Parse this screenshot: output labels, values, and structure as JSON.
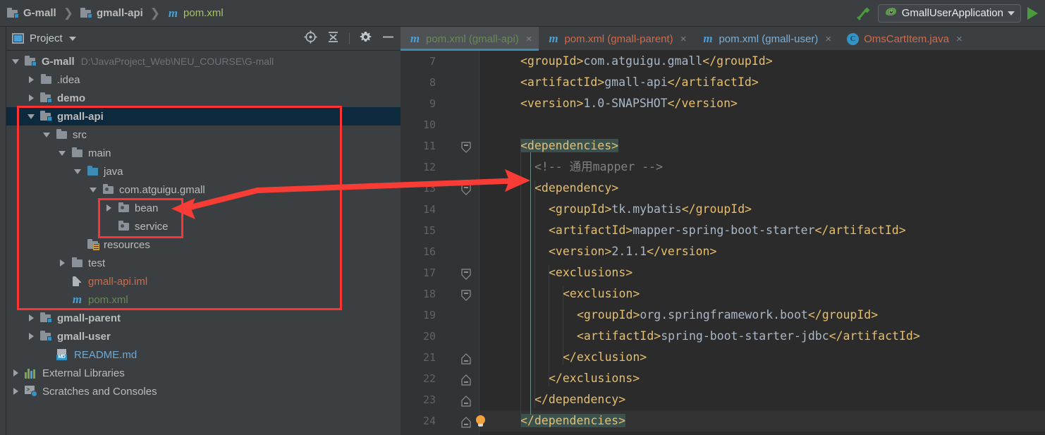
{
  "navbar": {
    "breadcrumbs": [
      {
        "label": "G-mall",
        "icon": "module-folder-icon",
        "style": "bold"
      },
      {
        "label": "gmall-api",
        "icon": "module-folder-icon",
        "style": "bold"
      },
      {
        "label": "pom.xml",
        "icon": "maven-m-icon",
        "style": "green"
      }
    ],
    "separator": "❯",
    "hammer_icon": "hammer-build-icon",
    "run_config": {
      "label": "GmallUserApplication",
      "icon": "spring-boot-icon",
      "caret": "chevron-down-icon"
    },
    "run_button": "run-play-icon",
    "accent_green": "#4a9b3e"
  },
  "project_panel": {
    "title": "Project",
    "title_icon": "project-view-icon",
    "caret": "chevron-down-icon",
    "actions": [
      {
        "name": "locate-target-icon",
        "glyph": "⊕"
      },
      {
        "name": "collapse-all-icon",
        "glyph": "⤓"
      },
      {
        "name": "settings-gear-icon",
        "glyph": "⚙"
      },
      {
        "name": "hide-panel-icon",
        "glyph": "—"
      }
    ]
  },
  "tree": [
    {
      "label": "G-mall",
      "sub": "D:\\JavaProject_Web\\NEU_COURSE\\G-mall",
      "depth": 0,
      "arrow": "open",
      "icon": "module-folder-icon",
      "bold": true,
      "color": "grey"
    },
    {
      "label": ".idea",
      "sub": "",
      "depth": 1,
      "arrow": "closed",
      "icon": "folder-icon",
      "bold": false,
      "color": "grey"
    },
    {
      "label": "demo",
      "sub": "",
      "depth": 1,
      "arrow": "closed",
      "icon": "module-folder-icon",
      "bold": true,
      "color": "grey"
    },
    {
      "label": "gmall-api",
      "sub": "",
      "depth": 1,
      "arrow": "open",
      "icon": "module-folder-icon",
      "bold": true,
      "color": "grey",
      "selected": true
    },
    {
      "label": "src",
      "sub": "",
      "depth": 2,
      "arrow": "open",
      "icon": "folder-icon",
      "bold": false,
      "color": "grey"
    },
    {
      "label": "main",
      "sub": "",
      "depth": 3,
      "arrow": "open",
      "icon": "folder-icon",
      "bold": false,
      "color": "grey"
    },
    {
      "label": "java",
      "sub": "",
      "depth": 4,
      "arrow": "open",
      "icon": "source-folder-icon",
      "bold": false,
      "color": "grey"
    },
    {
      "label": "com.atguigu.gmall",
      "sub": "",
      "depth": 5,
      "arrow": "open",
      "icon": "package-icon",
      "bold": false,
      "color": "grey"
    },
    {
      "label": "bean",
      "sub": "",
      "depth": 6,
      "arrow": "closed",
      "icon": "package-icon",
      "bold": false,
      "color": "grey"
    },
    {
      "label": "service",
      "sub": "",
      "depth": 6,
      "arrow": "none",
      "icon": "package-icon",
      "bold": false,
      "color": "grey"
    },
    {
      "label": "resources",
      "sub": "",
      "depth": 4,
      "arrow": "none",
      "icon": "resources-folder-icon",
      "bold": false,
      "color": "grey"
    },
    {
      "label": "test",
      "sub": "",
      "depth": 3,
      "arrow": "closed",
      "icon": "folder-icon",
      "bold": false,
      "color": "grey"
    },
    {
      "label": "gmall-api.iml",
      "sub": "",
      "depth": 3,
      "arrow": "none",
      "icon": "iml-file-icon",
      "bold": false,
      "color": "salmon"
    },
    {
      "label": "pom.xml",
      "sub": "",
      "depth": 3,
      "arrow": "none",
      "icon": "maven-m-icon",
      "bold": false,
      "color": "green"
    },
    {
      "label": "gmall-parent",
      "sub": "",
      "depth": 1,
      "arrow": "closed",
      "icon": "module-folder-icon",
      "bold": true,
      "color": "grey"
    },
    {
      "label": "gmall-user",
      "sub": "",
      "depth": 1,
      "arrow": "closed",
      "icon": "module-folder-icon",
      "bold": true,
      "color": "grey"
    },
    {
      "label": "README.md",
      "sub": "",
      "depth": 2,
      "arrow": "none",
      "icon": "markdown-file-icon",
      "bold": false,
      "color": "blue"
    },
    {
      "label": "External Libraries",
      "sub": "",
      "depth": 0,
      "arrow": "closed",
      "icon": "external-libraries-icon",
      "bold": false,
      "color": "grey"
    },
    {
      "label": "Scratches and Consoles",
      "sub": "",
      "depth": 0,
      "arrow": "closed",
      "icon": "scratches-icon",
      "bold": false,
      "color": "grey"
    }
  ],
  "tabs": [
    {
      "label": "pom.xml (gmall-api)",
      "icon": "maven-m-icon",
      "color": "green",
      "active": true,
      "close": "×"
    },
    {
      "label": "pom.xml (gmall-parent)",
      "icon": "maven-m-icon",
      "color": "salmon",
      "active": false,
      "close": "×"
    },
    {
      "label": "pom.xml (gmall-user)",
      "icon": "maven-m-icon",
      "color": "blue",
      "active": false,
      "close": "×"
    },
    {
      "label": "OmsCartItem.java",
      "icon": "java-class-icon",
      "color": "salmon",
      "active": false,
      "close": "×"
    }
  ],
  "editor": {
    "first_line": 7,
    "current_line": 24,
    "lines": [
      {
        "n": 7,
        "indent": 4,
        "segments": [
          {
            "t": "<groupId>",
            "c": "tag"
          },
          {
            "t": "com.atguigu.gmall",
            "c": "val"
          },
          {
            "t": "</groupId>",
            "c": "tag"
          }
        ]
      },
      {
        "n": 8,
        "indent": 4,
        "segments": [
          {
            "t": "<artifactId>",
            "c": "tag"
          },
          {
            "t": "gmall-api",
            "c": "val"
          },
          {
            "t": "</artifactId>",
            "c": "tag"
          }
        ]
      },
      {
        "n": 9,
        "indent": 4,
        "segments": [
          {
            "t": "<version>",
            "c": "tag"
          },
          {
            "t": "1.0-SNAPSHOT",
            "c": "val"
          },
          {
            "t": "</version>",
            "c": "tag"
          }
        ]
      },
      {
        "n": 10,
        "indent": 0,
        "segments": []
      },
      {
        "n": 11,
        "indent": 4,
        "fold": "start",
        "segments": [
          {
            "t": "<dependencies>",
            "c": "tag",
            "hl": true
          }
        ]
      },
      {
        "n": 12,
        "indent": 6,
        "segments": [
          {
            "t": "<!-- 通用mapper -->",
            "c": "cmt"
          }
        ]
      },
      {
        "n": 13,
        "indent": 6,
        "fold": "start",
        "segments": [
          {
            "t": "<dependency>",
            "c": "tag"
          }
        ]
      },
      {
        "n": 14,
        "indent": 8,
        "segments": [
          {
            "t": "<groupId>",
            "c": "tag"
          },
          {
            "t": "tk.mybatis",
            "c": "val"
          },
          {
            "t": "</groupId>",
            "c": "tag"
          }
        ]
      },
      {
        "n": 15,
        "indent": 8,
        "segments": [
          {
            "t": "<artifactId>",
            "c": "tag"
          },
          {
            "t": "mapper-spring-boot-starter",
            "c": "val"
          },
          {
            "t": "</artifactId>",
            "c": "tag"
          }
        ]
      },
      {
        "n": 16,
        "indent": 8,
        "segments": [
          {
            "t": "<version>",
            "c": "tag"
          },
          {
            "t": "2.1.1",
            "c": "val"
          },
          {
            "t": "</version>",
            "c": "tag"
          }
        ]
      },
      {
        "n": 17,
        "indent": 8,
        "fold": "start",
        "segments": [
          {
            "t": "<exclusions>",
            "c": "tag"
          }
        ]
      },
      {
        "n": 18,
        "indent": 10,
        "fold": "start",
        "segments": [
          {
            "t": "<exclusion>",
            "c": "tag"
          }
        ]
      },
      {
        "n": 19,
        "indent": 12,
        "segments": [
          {
            "t": "<groupId>",
            "c": "tag"
          },
          {
            "t": "org.springframework.boot",
            "c": "val"
          },
          {
            "t": "</groupId>",
            "c": "tag"
          }
        ]
      },
      {
        "n": 20,
        "indent": 12,
        "segments": [
          {
            "t": "<artifactId>",
            "c": "tag"
          },
          {
            "t": "spring-boot-starter-jdbc",
            "c": "val"
          },
          {
            "t": "</artifactId>",
            "c": "tag"
          }
        ]
      },
      {
        "n": 21,
        "indent": 10,
        "fold": "end",
        "segments": [
          {
            "t": "</exclusion>",
            "c": "tag"
          }
        ]
      },
      {
        "n": 22,
        "indent": 8,
        "fold": "end",
        "segments": [
          {
            "t": "</exclusions>",
            "c": "tag"
          }
        ]
      },
      {
        "n": 23,
        "indent": 6,
        "fold": "end",
        "segments": [
          {
            "t": "</dependency>",
            "c": "tag"
          }
        ]
      },
      {
        "n": 24,
        "indent": 4,
        "fold": "end",
        "bulb": true,
        "segments": [
          {
            "t": "</dependencies>",
            "c": "tag",
            "hl": true
          }
        ]
      }
    ]
  },
  "annotations": {
    "color": "#ff3333",
    "outer_box": {
      "label": "highlight-rectangle-gmall-api-module"
    },
    "inner_box": {
      "label": "highlight-rectangle-bean-service"
    },
    "arrow": {
      "label": "double-headed-arrow-bean-to-dependency"
    }
  },
  "colors": {
    "panel_bg": "#3c3f41",
    "editor_bg": "#2b2b2b",
    "gutter_bg": "#313335",
    "selection_bg": "#0d293e",
    "tab_active_bg": "#4e5254",
    "tab_underline": "#3d8ab5",
    "xml_tag": "#e8bf6a",
    "xml_value": "#a9b7c6",
    "comment": "#808080",
    "brace_match": "#3b514d",
    "annotation_red": "#ff3333"
  }
}
